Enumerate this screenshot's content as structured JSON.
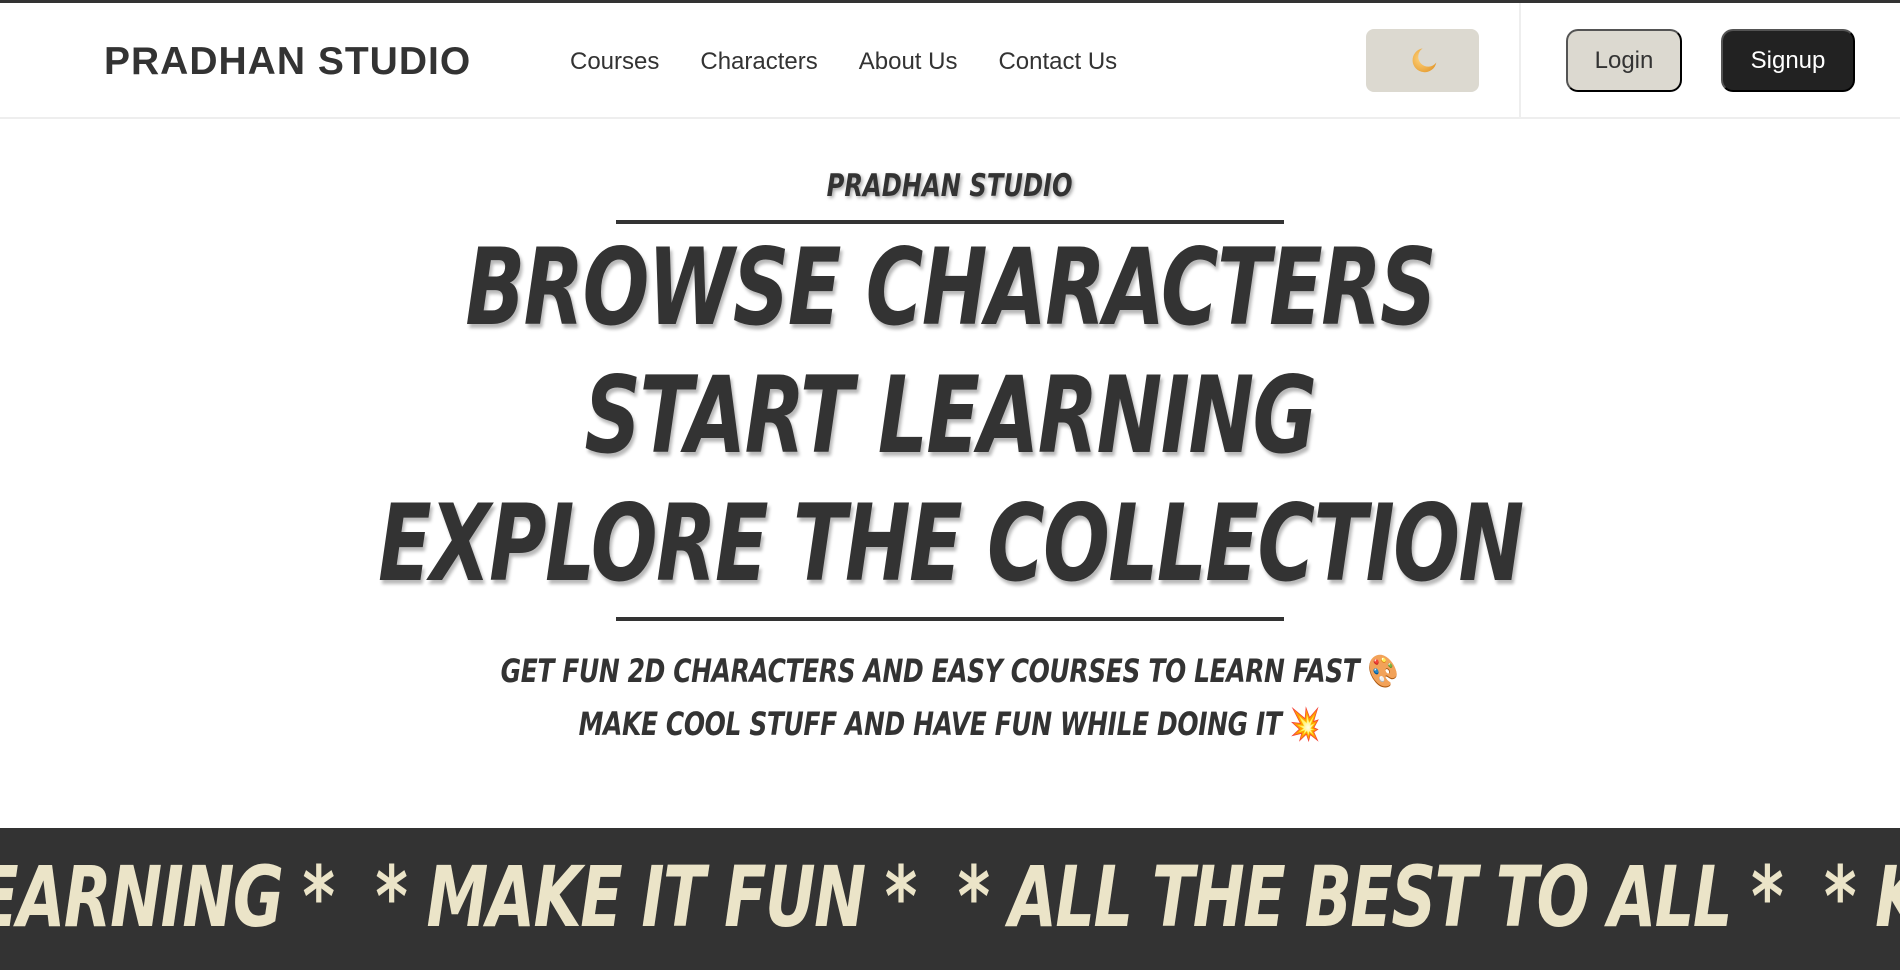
{
  "navbar": {
    "brand": "PRADHAN STUDIO",
    "links": [
      "Courses",
      "Characters",
      "About Us",
      "Contact Us"
    ],
    "theme_toggle_icon": "moon-icon",
    "login_label": "Login",
    "signup_label": "Signup"
  },
  "hero": {
    "eyebrow": "PRADHAN STUDIO",
    "headline": [
      "BROWSE CHARACTERS",
      "START LEARNING",
      "EXPLORE THE COLLECTION"
    ],
    "subtitle": [
      {
        "text": "GET FUN 2D CHARACTERS AND EASY COURSES TO LEARN FAST",
        "emoji": "🎨"
      },
      {
        "text": "MAKE COOL STUFF AND HAVE FUN WHILE DOING IT",
        "emoji": "💥"
      }
    ]
  },
  "marquee": {
    "items": [
      "LEARNING *",
      "* MAKE IT FUN *",
      "* ALL THE BEST TO ALL *",
      "* KEEP CREATING"
    ]
  },
  "colors": {
    "text": "#333333",
    "button_light": "#dcd9d0",
    "button_dark": "#222222",
    "marquee_bg": "#333333",
    "marquee_text": "#ebe4c8"
  }
}
